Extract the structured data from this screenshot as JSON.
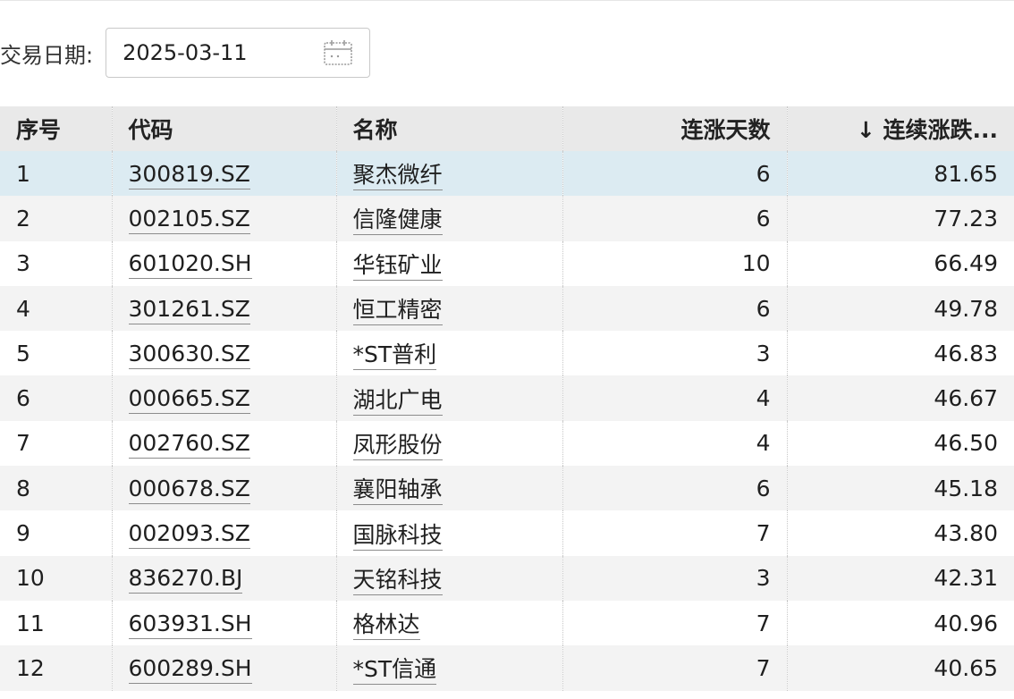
{
  "filter": {
    "label": "交易日期:",
    "date": "2025-03-11"
  },
  "table": {
    "headers": [
      "序号",
      "代码",
      "名称",
      "连涨天数",
      "↓ 连续涨跌..."
    ],
    "rows": [
      {
        "idx": "1",
        "code": "300819.SZ",
        "name": "聚杰微纤",
        "days": "6",
        "pct": "81.65"
      },
      {
        "idx": "2",
        "code": "002105.SZ",
        "name": "信隆健康",
        "days": "6",
        "pct": "77.23"
      },
      {
        "idx": "3",
        "code": "601020.SH",
        "name": "华钰矿业",
        "days": "10",
        "pct": "66.49"
      },
      {
        "idx": "4",
        "code": "301261.SZ",
        "name": "恒工精密",
        "days": "6",
        "pct": "49.78"
      },
      {
        "idx": "5",
        "code": "300630.SZ",
        "name": "*ST普利",
        "days": "3",
        "pct": "46.83"
      },
      {
        "idx": "6",
        "code": "000665.SZ",
        "name": "湖北广电",
        "days": "4",
        "pct": "46.67"
      },
      {
        "idx": "7",
        "code": "002760.SZ",
        "name": "凤形股份",
        "days": "4",
        "pct": "46.50"
      },
      {
        "idx": "8",
        "code": "000678.SZ",
        "name": "襄阳轴承",
        "days": "6",
        "pct": "45.18"
      },
      {
        "idx": "9",
        "code": "002093.SZ",
        "name": "国脉科技",
        "days": "7",
        "pct": "43.80"
      },
      {
        "idx": "10",
        "code": "836270.BJ",
        "name": "天铭科技",
        "days": "3",
        "pct": "42.31"
      },
      {
        "idx": "11",
        "code": "603931.SH",
        "name": "格林达",
        "days": "7",
        "pct": "40.96"
      },
      {
        "idx": "12",
        "code": "600289.SH",
        "name": "*ST信通",
        "days": "7",
        "pct": "40.65"
      }
    ]
  },
  "icons": {
    "date_picker": "calendar-icon"
  }
}
